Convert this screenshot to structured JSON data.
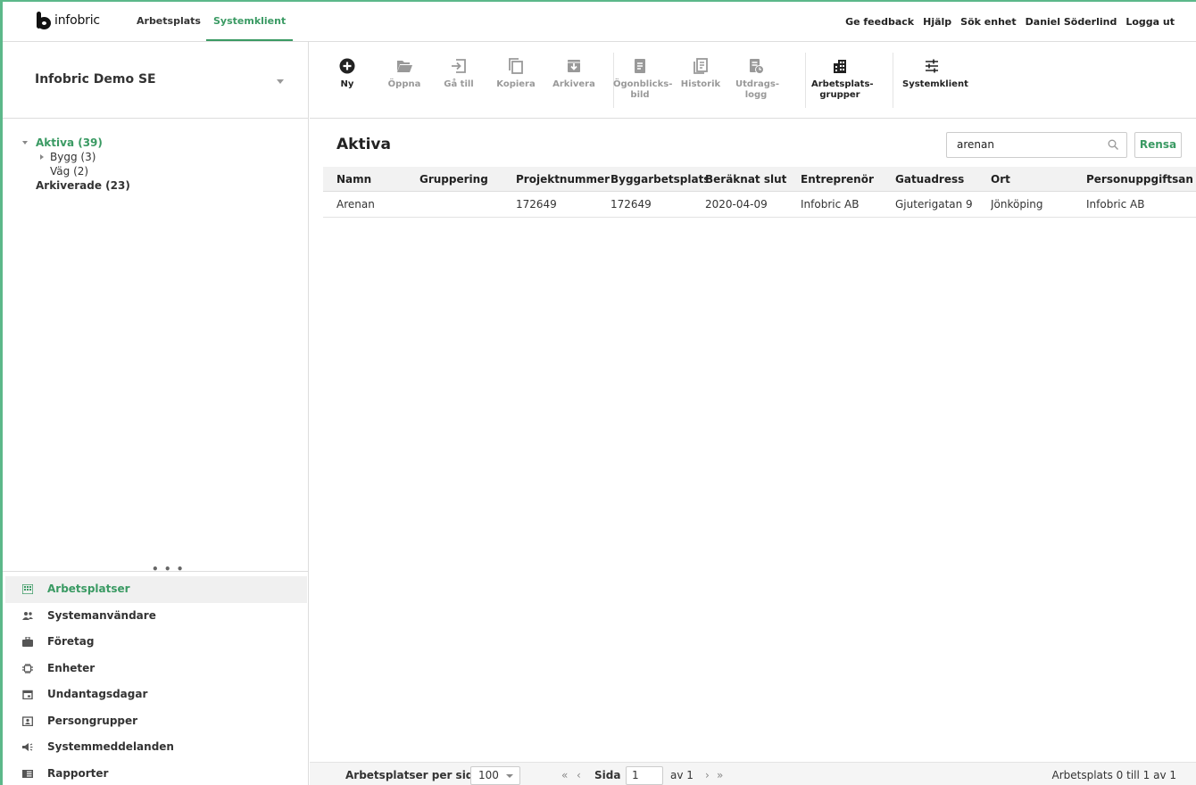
{
  "brand": "infobric",
  "topnav": {
    "tabs": [
      "Arbetsplats",
      "Systemklient"
    ],
    "active_tab": "Systemklient",
    "right_links": [
      "Ge feedback",
      "Hjälp",
      "Sök enhet",
      "Daniel Söderlind",
      "Logga ut"
    ]
  },
  "org": {
    "name": "Infobric Demo SE"
  },
  "tree": {
    "active": "Aktiva (39)",
    "children": [
      "Bygg (3)",
      "Väg (2)"
    ],
    "archived": "Arkiverade (23)"
  },
  "sidenav": {
    "items": [
      "Arbetsplatser",
      "Systemanvändare",
      "Företag",
      "Enheter",
      "Undantagsdagar",
      "Persongrupper",
      "Systemmeddelanden",
      "Rapporter"
    ],
    "active": "Arbetsplatser"
  },
  "toolbar": {
    "ny": "Ny",
    "oppna": "Öppna",
    "ga_till": "Gå till",
    "kopiera": "Kopiera",
    "arkivera": "Arkivera",
    "ogonblicks_1": "Ögonblicks-",
    "ogonblicks_2": "bild",
    "historik": "Historik",
    "utdrags_1": "Utdrags-",
    "utdrags_2": "logg",
    "arbetsplatsgrupper_1": "Arbetsplats-",
    "arbetsplatsgrupper_2": "grupper",
    "systemklient": "Systemklient"
  },
  "main": {
    "title": "Aktiva",
    "search_value": "arenan",
    "clear_label": "Rensa",
    "columns": [
      "Namn",
      "Gruppering",
      "Projektnummer",
      "Byggarbetsplats",
      "Beräknat slut",
      "Entreprenör",
      "Gatuadress",
      "Ort",
      "Personuppgiftsan"
    ],
    "rows": [
      [
        "Arenan",
        "",
        "172649",
        "172649",
        "2020-04-09",
        "Infobric AB",
        "Gjuterigatan 9",
        "Jönköping",
        "Infobric AB"
      ]
    ]
  },
  "footer": {
    "per_page_label": "Arbetsplatser per sida",
    "per_page_value": "100",
    "page_label": "Sida",
    "page_value": "1",
    "page_of": "av 1",
    "summary": "Arbetsplats 0 till 1 av 1"
  },
  "colors": {
    "accent": "#3a9a63",
    "border_accent": "#5cb88a"
  }
}
